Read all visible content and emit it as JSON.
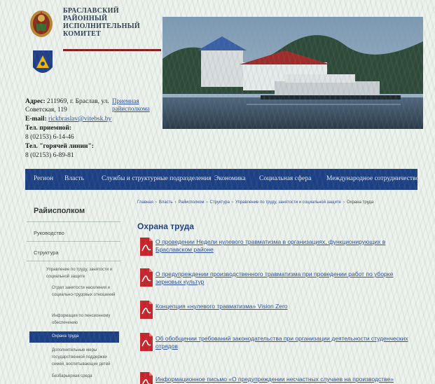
{
  "header": {
    "org_lines": [
      "БРАСЛАВСКИЙ",
      "РАЙОННЫЙ",
      "ИСПОЛНИТЕЛЬНЫЙ",
      "КОМИТЕТ"
    ],
    "address_label": "Адрес:",
    "address_value_1": "211969, г. Браслав, ул.",
    "address_value_2": "Советская, 119",
    "email_label": "E-mail:",
    "email_value": "rickbraslav@vitebsk.by",
    "phone_label": "Тел. приемной:",
    "phone_value": "8 (02153) 6-14-46",
    "hotline_label": "Тел. \"горячей линии\":",
    "hotline_value": "8 (02153) 6-89-81",
    "reception_link_1": "Приемная",
    "reception_link_2": "райисполкома"
  },
  "nav": {
    "items": [
      "Регион",
      "Власть",
      "Службы и структурные подразделения",
      "Экономика",
      "Социальная сфера",
      "Международное сотрудничество"
    ]
  },
  "sidebar": {
    "title": "Райисполком",
    "items": [
      "Руководство",
      "Структура"
    ],
    "sub_items": [
      "Управление по труду, занятости и социальной защите",
      "Отдел занятости населения и социально-трудовых отношений",
      "Информация по пенсионному обеспечению",
      "Охрана труда",
      "Дополнительные меры государственной поддержки семей, воспитывающих детей",
      "Безбарьерная среда"
    ]
  },
  "breadcrumb": [
    "Главная",
    "Власть",
    "Райисполком",
    "Структура",
    "Управление по труду, занятости и социальной защите",
    "Охрана труда"
  ],
  "page": {
    "title": "Охрана труда",
    "documents": [
      "О проведении Недели нулевого травматизма в организациях, функционирующих в Браславском районе",
      "О предупреждении производственного травматизма при проведении работ по уборке зерновых культур",
      "Концепция «нулевого травматизма» Vision Zero",
      "Об обобщении требований законодательства при организации деятельности студенческих отрядов",
      "Информационное письмо «О предупреждении несчастных случаев на производстве»"
    ]
  },
  "colors": {
    "nav_bg": "#1c3f86",
    "title_blue": "#1c3f86",
    "link_blue": "#2b4e9a",
    "accent_red": "#8b1c1c",
    "pdf_red": "#c8232a"
  },
  "icons": [
    "coat-of-arms",
    "emergency-emblem",
    "pdf-icon"
  ]
}
